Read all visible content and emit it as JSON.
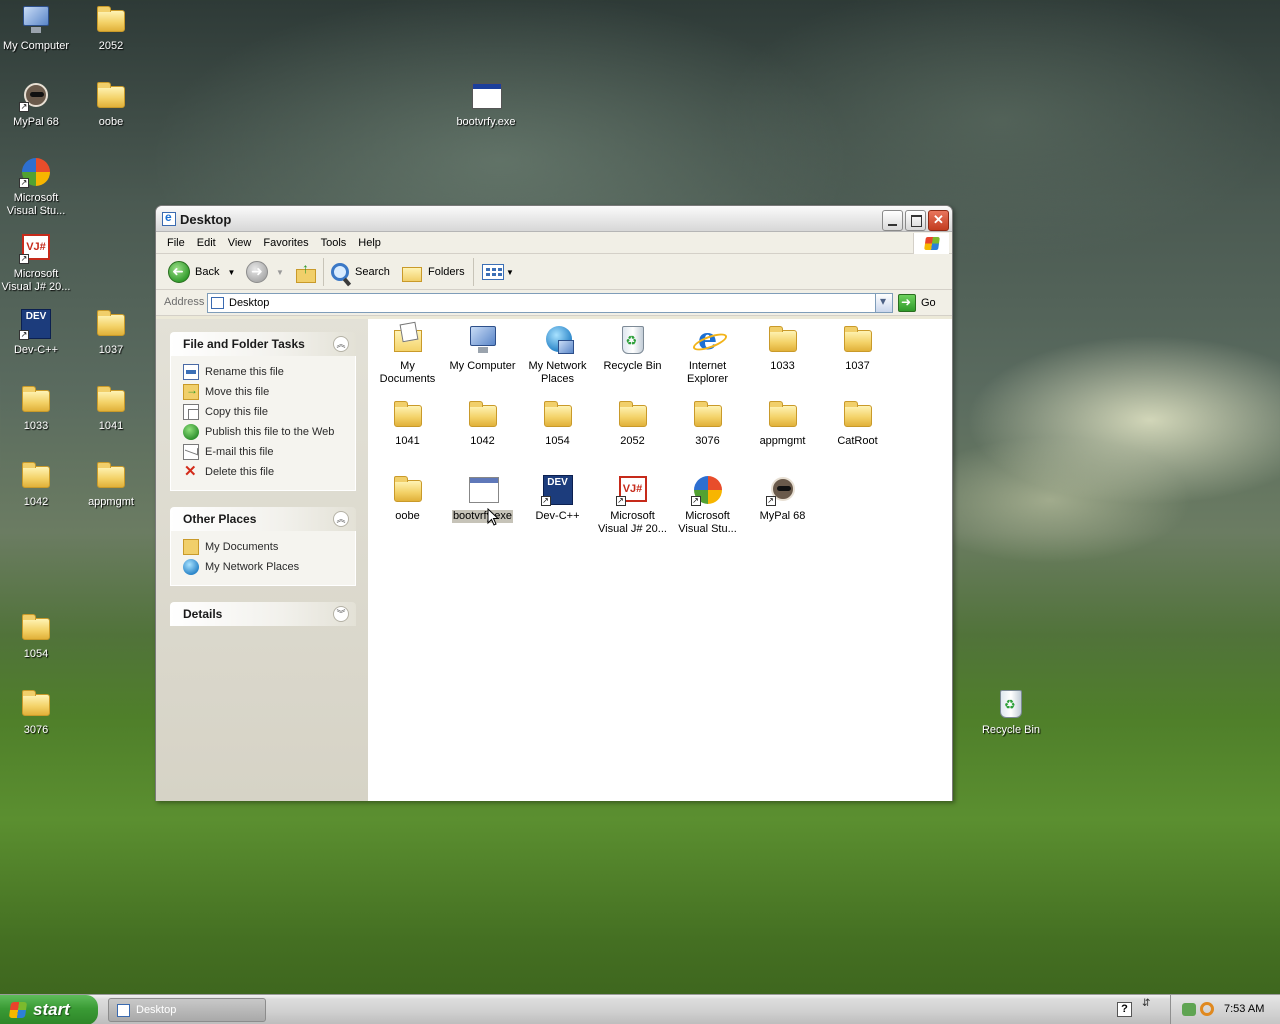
{
  "desktop": {
    "icons": [
      {
        "label": "My Computer",
        "icon": "my-computer-icon"
      },
      {
        "label": "2052",
        "icon": "folder-icon"
      },
      {
        "label": "MyPal 68",
        "icon": "mypal-icon"
      },
      {
        "label": "oobe",
        "icon": "folder-icon"
      },
      {
        "label": "bootvrfy.exe",
        "icon": "exe-icon"
      },
      {
        "label": "Microsoft Visual Stu...",
        "icon": "visual-studio-icon"
      },
      {
        "label": "Microsoft Visual J# 20...",
        "icon": "visual-j-sharp-icon"
      },
      {
        "label": "Dev-C++",
        "icon": "dev-cpp-icon"
      },
      {
        "label": "1037",
        "icon": "folder-icon"
      },
      {
        "label": "1033",
        "icon": "folder-icon"
      },
      {
        "label": "1041",
        "icon": "folder-icon"
      },
      {
        "label": "1042",
        "icon": "folder-icon"
      },
      {
        "label": "appmgmt",
        "icon": "folder-icon"
      },
      {
        "label": "1054",
        "icon": "folder-icon"
      },
      {
        "label": "3076",
        "icon": "folder-icon"
      },
      {
        "label": "Recycle Bin",
        "icon": "recycle-bin-icon"
      }
    ]
  },
  "window": {
    "title": "Desktop",
    "menu": [
      "File",
      "Edit",
      "View",
      "Favorites",
      "Tools",
      "Help"
    ],
    "toolbar": {
      "back": "Back",
      "search": "Search",
      "folders": "Folders"
    },
    "address": {
      "label": "Address",
      "value": "Desktop",
      "go": "Go"
    },
    "tasks_panel": {
      "title": "File and Folder Tasks",
      "items": [
        {
          "label": "Rename this file",
          "icon": "rename-icon"
        },
        {
          "label": "Move this file",
          "icon": "move-icon"
        },
        {
          "label": "Copy this file",
          "icon": "copy-icon"
        },
        {
          "label": "Publish this file to the Web",
          "icon": "publish-icon"
        },
        {
          "label": "E-mail this file",
          "icon": "email-icon"
        },
        {
          "label": "Delete this file",
          "icon": "delete-icon"
        }
      ]
    },
    "places_panel": {
      "title": "Other Places",
      "items": [
        {
          "label": "My Documents",
          "icon": "my-documents-icon"
        },
        {
          "label": "My Network Places",
          "icon": "network-places-icon"
        }
      ]
    },
    "details_panel": {
      "title": "Details"
    },
    "files": [
      {
        "label": "My Documents",
        "icon": "my-documents-icon"
      },
      {
        "label": "My Computer",
        "icon": "my-computer-icon"
      },
      {
        "label": "My Network Places",
        "icon": "network-places-icon"
      },
      {
        "label": "Recycle Bin",
        "icon": "recycle-bin-icon"
      },
      {
        "label": "Internet Explorer",
        "icon": "internet-explorer-icon"
      },
      {
        "label": "1033",
        "icon": "folder-icon"
      },
      {
        "label": "1037",
        "icon": "folder-icon"
      },
      {
        "label": "1041",
        "icon": "folder-icon"
      },
      {
        "label": "1042",
        "icon": "folder-icon"
      },
      {
        "label": "1054",
        "icon": "folder-icon"
      },
      {
        "label": "2052",
        "icon": "folder-icon"
      },
      {
        "label": "3076",
        "icon": "folder-icon"
      },
      {
        "label": "appmgmt",
        "icon": "folder-icon"
      },
      {
        "label": "CatRoot",
        "icon": "folder-icon"
      },
      {
        "label": "oobe",
        "icon": "folder-icon"
      },
      {
        "label": "bootvrfy.exe",
        "icon": "exe-icon",
        "selected": true
      },
      {
        "label": "Dev-C++",
        "icon": "dev-cpp-icon"
      },
      {
        "label": "Microsoft Visual J# 20...",
        "icon": "visual-j-sharp-icon"
      },
      {
        "label": "Microsoft Visual Stu...",
        "icon": "visual-studio-icon"
      },
      {
        "label": "MyPal 68",
        "icon": "mypal-icon"
      }
    ]
  },
  "taskbar": {
    "start": "start",
    "task_button": "Desktop",
    "clock": "7:53 AM"
  }
}
